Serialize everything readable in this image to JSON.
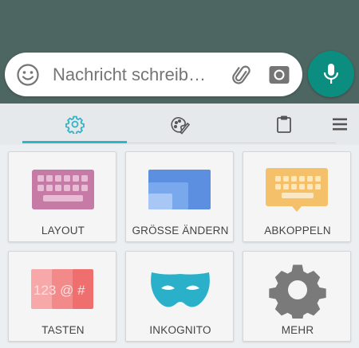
{
  "compose": {
    "placeholder": "Nachricht schreib…",
    "emoji_icon": "emoji-icon",
    "attach_icon": "paperclip-icon",
    "camera_icon": "camera-icon",
    "mic_icon": "microphone-icon"
  },
  "toolbar": {
    "tabs": [
      {
        "icon": "gear-icon",
        "selected": true
      },
      {
        "icon": "palette-icon",
        "selected": false
      },
      {
        "icon": "clipboard-icon",
        "selected": false
      }
    ],
    "menu_icon": "hamburger-menu-icon"
  },
  "tiles": [
    {
      "label": "LAYOUT",
      "icon": "keyboard-icon"
    },
    {
      "label": "GRÖSSE ÄNDERN",
      "icon": "resize-icon"
    },
    {
      "label": "ABKOPPELN",
      "icon": "undock-keyboard-icon"
    },
    {
      "label": "TASTEN",
      "icon": "keys-icon",
      "art_text": "123 @ #"
    },
    {
      "label": "INKOGNITO",
      "icon": "mask-icon"
    },
    {
      "label": "MEHR",
      "icon": "gear-icon"
    }
  ],
  "colors": {
    "chat_background": "#4e6662",
    "mic_button": "#0b8e7f",
    "tab_indicator": "#2fb4c8",
    "keyboard_tile": "#c57ba6",
    "resize_tile": "#5c8fe0",
    "undock_tile": "#f4c06a",
    "keys_tile": "#ef6f6f",
    "incognito_tile": "#2ab0c8",
    "more_tile": "#7a7a7a"
  }
}
